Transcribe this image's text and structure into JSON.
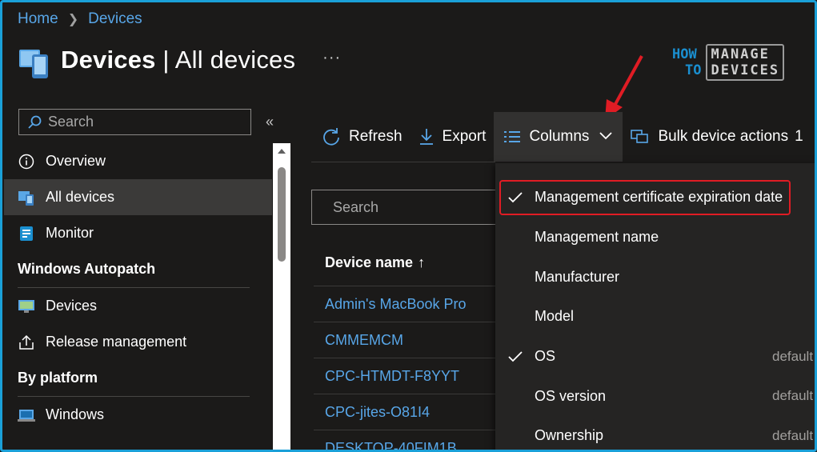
{
  "breadcrumb": {
    "home": "Home",
    "current": "Devices"
  },
  "page": {
    "title": "Devices",
    "separator": " | ",
    "subtitle": "All devices",
    "more": "···"
  },
  "logo": {
    "line1": "HOW",
    "line2": "TO",
    "manage": "MANAGE",
    "devices": "DEVICES"
  },
  "sidebar": {
    "search_placeholder": "Search",
    "collapse": "«",
    "items": [
      {
        "label": "Overview",
        "icon": "info-icon"
      },
      {
        "label": "All devices",
        "icon": "devices-icon",
        "active": true
      },
      {
        "label": "Monitor",
        "icon": "monitor-icon"
      }
    ],
    "group_autopatch": "Windows Autopatch",
    "autopatch_items": [
      {
        "label": "Devices",
        "icon": "autopatch-devices-icon"
      },
      {
        "label": "Release management",
        "icon": "upload-icon"
      }
    ],
    "group_platform": "By platform",
    "platform_items": [
      {
        "label": "Windows",
        "icon": "windows-laptop-icon"
      }
    ]
  },
  "toolbar": {
    "refresh": "Refresh",
    "export": "Export",
    "columns": "Columns",
    "bulk": "Bulk device actions",
    "extra": "1"
  },
  "main": {
    "search_placeholder": "Search",
    "column_header": "Device name",
    "sort_indicator": "↑",
    "rows": [
      "Admin's MacBook Pro",
      "CMMEMCM",
      "CPC-HTMDT-F8YYT",
      "CPC-jites-O81I4",
      "DESKTOP-40FIM1B"
    ]
  },
  "columns_dropdown": {
    "items": [
      {
        "label": "Management certificate expiration date",
        "checked": true,
        "default": ""
      },
      {
        "label": "Management name",
        "checked": false,
        "default": ""
      },
      {
        "label": "Manufacturer",
        "checked": false,
        "default": ""
      },
      {
        "label": "Model",
        "checked": false,
        "default": ""
      },
      {
        "label": "OS",
        "checked": true,
        "default": "default"
      },
      {
        "label": "OS version",
        "checked": false,
        "default": "default"
      },
      {
        "label": "Ownership",
        "checked": false,
        "default": "default"
      }
    ]
  },
  "colors": {
    "accent": "#58a6e8",
    "highlight": "#e01c24",
    "background": "#1b1a19"
  }
}
